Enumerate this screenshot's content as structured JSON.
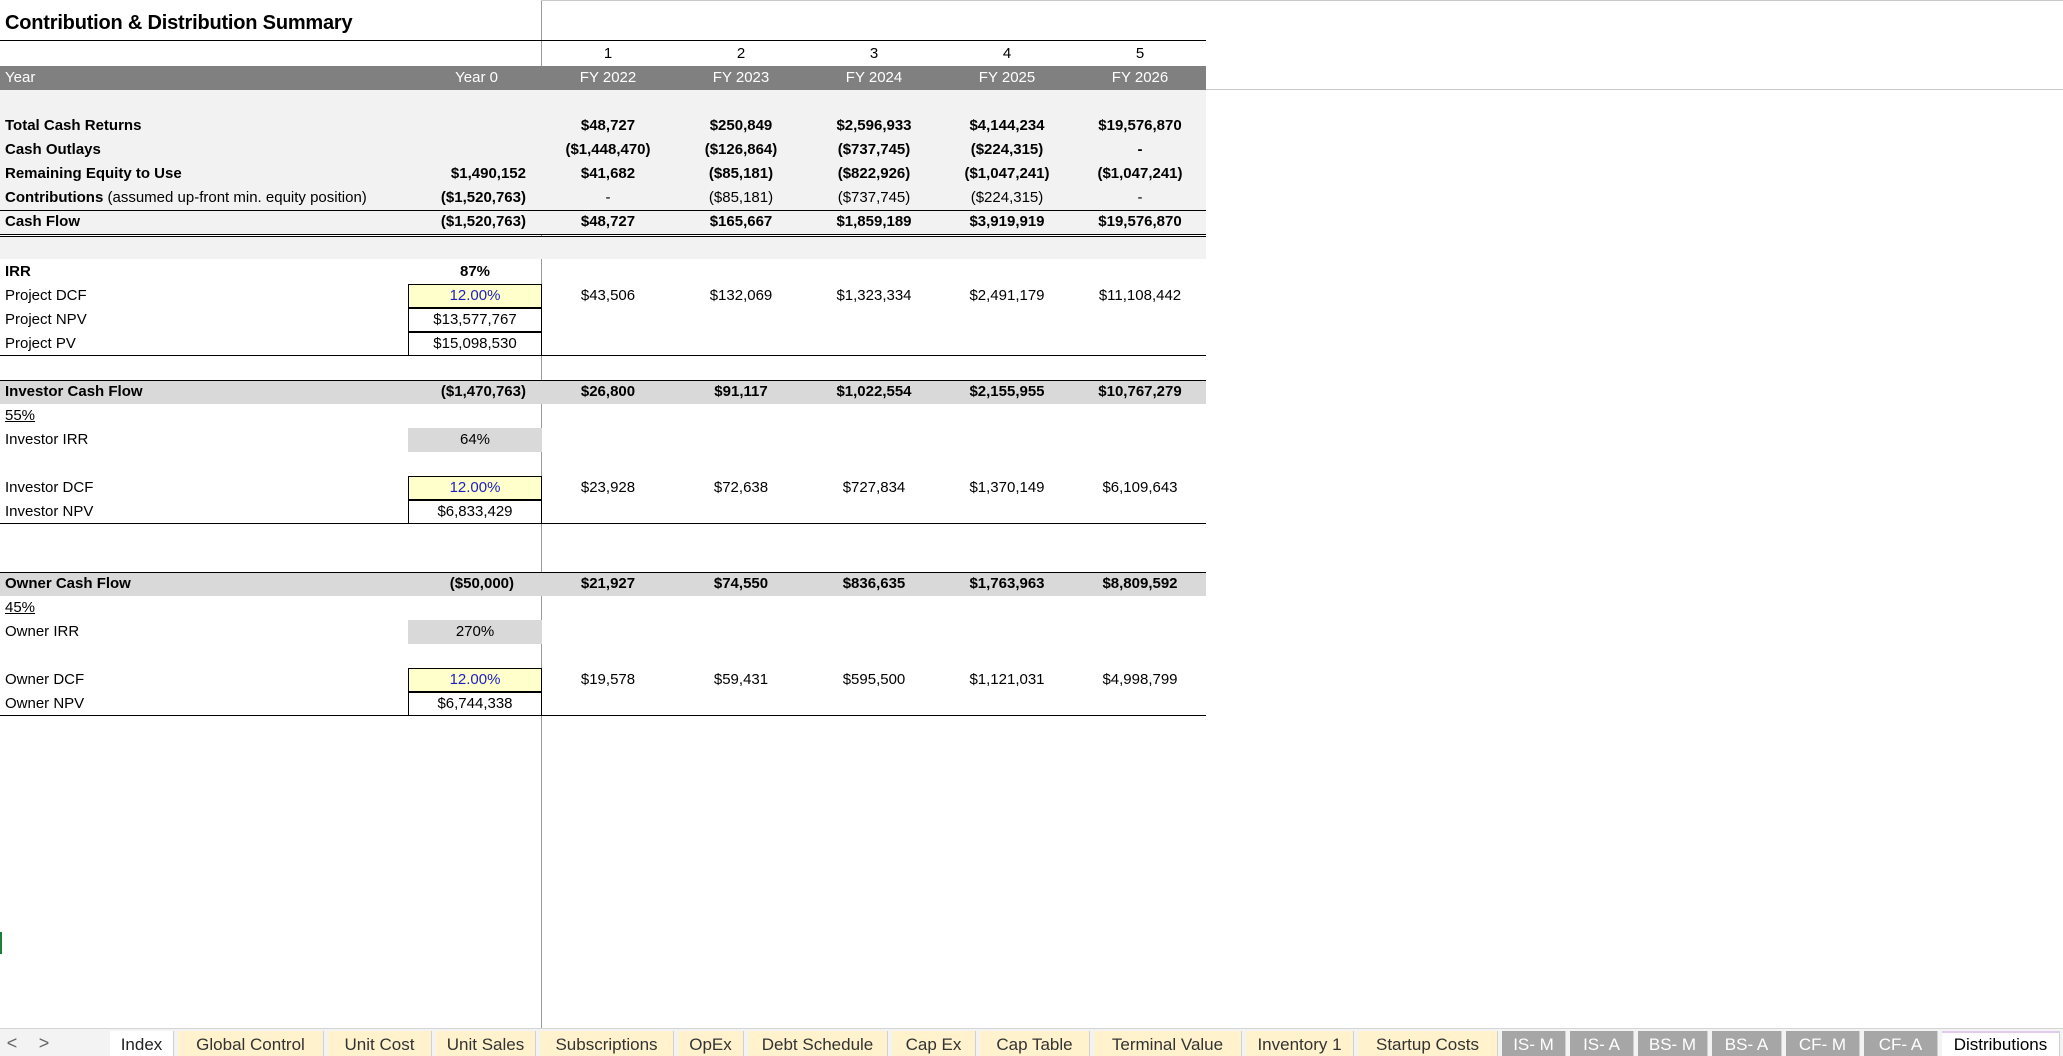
{
  "sheet": {
    "title": "Contribution & Distribution Summary",
    "period_numbers": [
      "1",
      "2",
      "3",
      "4",
      "5"
    ],
    "header": {
      "year_label": "Year",
      "year0_label": "Year 0",
      "years": [
        "FY 2022",
        "FY 2023",
        "FY 2024",
        "FY 2025",
        "FY 2026"
      ]
    },
    "summary_rows": [
      {
        "label": "Total Cash Returns",
        "note": "",
        "year0": "",
        "values": [
          "$48,727",
          "$250,849",
          "$2,596,933",
          "$4,144,234",
          "$19,576,870"
        ]
      },
      {
        "label": "Cash Outlays",
        "note": "",
        "year0": "",
        "values": [
          "($1,448,470)",
          "($126,864)",
          "($737,745)",
          "($224,315)",
          "-"
        ]
      },
      {
        "label": "Remaining Equity to Use",
        "note": "",
        "year0": "$1,490,152",
        "values": [
          "$41,682",
          "($85,181)",
          "($822,926)",
          "($1,047,241)",
          "($1,047,241)"
        ]
      },
      {
        "label": "Contributions",
        "note": " (assumed up-front min. equity position)",
        "year0": "($1,520,763)",
        "values": [
          "-",
          "($85,181)",
          "($737,745)",
          "($224,315)",
          "-"
        ]
      },
      {
        "label": "Cash Flow",
        "note": "",
        "year0": "($1,520,763)",
        "values": [
          "$48,727",
          "$165,667",
          "$1,859,189",
          "$3,919,919",
          "$19,576,870"
        ]
      }
    ],
    "project": {
      "irr_label": "IRR",
      "irr_value": "87%",
      "dcf_label": "Project DCF",
      "dcf_rate": "12.00%",
      "dcf_values": [
        "$43,506",
        "$132,069",
        "$1,323,334",
        "$2,491,179",
        "$11,108,442"
      ],
      "npv_label": "Project NPV",
      "npv_value": "$13,577,767",
      "pv_label": "Project PV",
      "pv_value": "$15,098,530"
    },
    "investor": {
      "cf_label": "Investor Cash Flow",
      "cf_year0": "($1,470,763)",
      "cf_values": [
        "$26,800",
        "$91,117",
        "$1,022,554",
        "$2,155,955",
        "$10,767,279"
      ],
      "share": "55%",
      "irr_label": "Investor IRR",
      "irr_value": "64%",
      "dcf_label": "Investor DCF",
      "dcf_rate": "12.00%",
      "dcf_values": [
        "$23,928",
        "$72,638",
        "$727,834",
        "$1,370,149",
        "$6,109,643"
      ],
      "npv_label": "Investor NPV",
      "npv_value": "$6,833,429"
    },
    "owner": {
      "cf_label": "Owner Cash Flow",
      "cf_year0": "($50,000)",
      "cf_values": [
        "$21,927",
        "$74,550",
        "$836,635",
        "$1,763,963",
        "$8,809,592"
      ],
      "share": "45%",
      "irr_label": "Owner IRR",
      "irr_value": "270%",
      "dcf_label": "Owner DCF",
      "dcf_rate": "12.00%",
      "dcf_values": [
        "$19,578",
        "$59,431",
        "$595,500",
        "$1,121,031",
        "$4,998,799"
      ],
      "npv_label": "Owner NPV",
      "npv_value": "$6,744,338"
    }
  },
  "tabbar": {
    "prev": "<",
    "next": ">",
    "tabs": [
      {
        "label": "Index",
        "style": "index"
      },
      {
        "label": "Global Control",
        "style": "yel"
      },
      {
        "label": "Unit Cost",
        "style": "yel"
      },
      {
        "label": "Unit Sales",
        "style": "yel"
      },
      {
        "label": "Subscriptions",
        "style": "yel"
      },
      {
        "label": "OpEx",
        "style": "yel"
      },
      {
        "label": "Debt Schedule",
        "style": "yel"
      },
      {
        "label": "Cap Ex",
        "style": "yel"
      },
      {
        "label": "Cap Table",
        "style": "yel"
      },
      {
        "label": "Terminal Value",
        "style": "yel"
      },
      {
        "label": "Inventory 1",
        "style": "yel"
      },
      {
        "label": "Startup Costs",
        "style": "yel"
      },
      {
        "label": "IS- M",
        "style": "gry"
      },
      {
        "label": "IS- A",
        "style": "gry"
      },
      {
        "label": "BS- M",
        "style": "gry"
      },
      {
        "label": "BS- A",
        "style": "gry"
      },
      {
        "label": "CF- M",
        "style": "gry"
      },
      {
        "label": "CF- A",
        "style": "gry"
      },
      {
        "label": "Distributions",
        "style": "active"
      }
    ]
  }
}
